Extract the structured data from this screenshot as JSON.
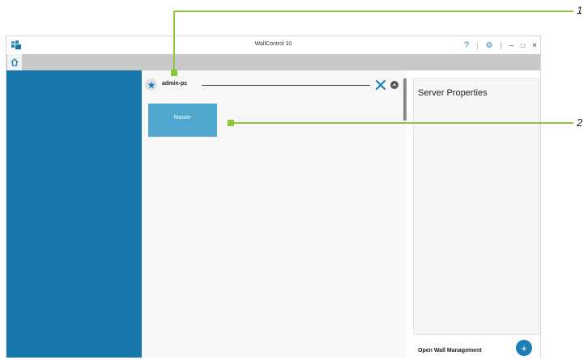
{
  "window": {
    "title": "WallControl 10",
    "controls": {
      "help": "?",
      "separator": "|",
      "minimize": "–",
      "maximize": "□",
      "close": "×"
    }
  },
  "tabs": {
    "home_icon": "home-icon"
  },
  "server": {
    "name": "admin-pc"
  },
  "main": {
    "master_label": "Master"
  },
  "properties": {
    "title": "Server Properties"
  },
  "footer": {
    "open_wall_label": "Open Wall Management",
    "add_label": "+"
  },
  "callouts": {
    "one": "1",
    "two": "2"
  },
  "colors": {
    "sidebar": "#1878ab",
    "master_button": "#4fa6cf",
    "accent": "#2a88c4",
    "callout": "#8cc63f",
    "tabbar": "#c8c8c8"
  }
}
